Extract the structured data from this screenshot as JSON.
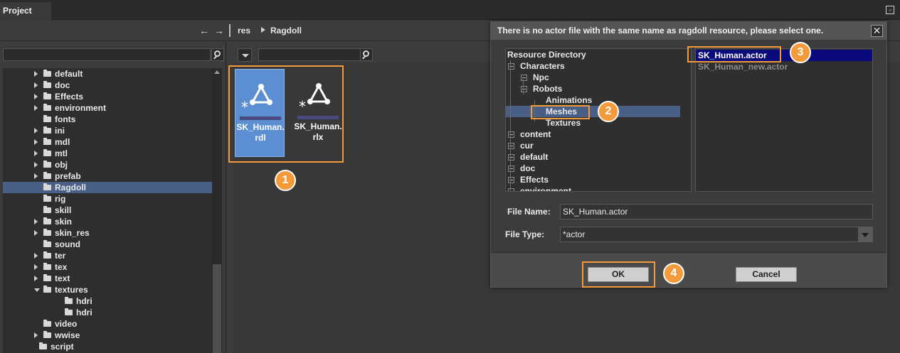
{
  "topbar": {
    "tab_label": "Project",
    "panel_icon": "restore-panel-icon"
  },
  "navbar": {
    "back": "←",
    "forward": "→",
    "crumbs": [
      "res",
      "Ragdoll"
    ]
  },
  "left_tree": {
    "items": [
      {
        "label": "default",
        "expanded": false,
        "has_arrow": true
      },
      {
        "label": "doc",
        "expanded": false,
        "has_arrow": true
      },
      {
        "label": "Effects",
        "expanded": false,
        "has_arrow": true
      },
      {
        "label": "environment",
        "expanded": false,
        "has_arrow": true
      },
      {
        "label": "fonts",
        "expanded": false,
        "has_arrow": false
      },
      {
        "label": "ini",
        "expanded": false,
        "has_arrow": true
      },
      {
        "label": "mdl",
        "expanded": false,
        "has_arrow": true
      },
      {
        "label": "mtl",
        "expanded": false,
        "has_arrow": true
      },
      {
        "label": "obj",
        "expanded": false,
        "has_arrow": true
      },
      {
        "label": "prefab",
        "expanded": false,
        "has_arrow": true
      },
      {
        "label": "Ragdoll",
        "expanded": false,
        "has_arrow": false,
        "selected": true
      },
      {
        "label": "rig",
        "expanded": false,
        "has_arrow": false
      },
      {
        "label": "skill",
        "expanded": false,
        "has_arrow": false
      },
      {
        "label": "skin",
        "expanded": false,
        "has_arrow": true
      },
      {
        "label": "skin_res",
        "expanded": false,
        "has_arrow": true
      },
      {
        "label": "sound",
        "expanded": false,
        "has_arrow": false
      },
      {
        "label": "ter",
        "expanded": false,
        "has_arrow": true
      },
      {
        "label": "tex",
        "expanded": false,
        "has_arrow": true
      },
      {
        "label": "text",
        "expanded": false,
        "has_arrow": true
      },
      {
        "label": "textures",
        "expanded": true,
        "has_arrow": true
      },
      {
        "label": "hdri",
        "expanded": false,
        "has_arrow": false,
        "child": true
      },
      {
        "label": "hdri",
        "expanded": false,
        "has_arrow": false,
        "child": true
      },
      {
        "label": "video",
        "expanded": false,
        "has_arrow": false
      },
      {
        "label": "wwise",
        "expanded": false,
        "has_arrow": true
      },
      {
        "label": "script",
        "expanded": false,
        "has_arrow": false,
        "root": true
      }
    ]
  },
  "files": [
    {
      "name": "SK_Human.rdl",
      "selected": true
    },
    {
      "name": "SK_Human.rlx",
      "selected": false
    }
  ],
  "dialog": {
    "title": "There is no actor file with the same name as ragdoll resource, please select one.",
    "close": "✕",
    "dir_tree": [
      {
        "label": "Resource Directory",
        "level": 0
      },
      {
        "label": "Characters",
        "level": 0
      },
      {
        "label": "Npc",
        "level": 1
      },
      {
        "label": "Robots",
        "level": 1
      },
      {
        "label": "Animations",
        "level": 2
      },
      {
        "label": "Meshes",
        "level": 2,
        "selected": true
      },
      {
        "label": "Textures",
        "level": 2
      },
      {
        "label": "content",
        "level": 0
      },
      {
        "label": "cur",
        "level": 0
      },
      {
        "label": "default",
        "level": 0
      },
      {
        "label": "doc",
        "level": 0
      },
      {
        "label": "Effects",
        "level": 0
      },
      {
        "label": "environment",
        "level": 0
      }
    ],
    "file_list": [
      {
        "label": "SK_Human.actor",
        "selected": true
      },
      {
        "label": "SK_Human_new.actor",
        "selected": false
      }
    ],
    "file_name_label": "File Name:",
    "file_name_value": "SK_Human.actor",
    "file_type_label": "File Type:",
    "file_type_value": "*actor",
    "ok_label": "OK",
    "cancel_label": "Cancel"
  },
  "steps": [
    "1",
    "2",
    "3",
    "4"
  ],
  "colors": {
    "highlight": "#f39a3a",
    "selection": "#4a5f85",
    "file_selected": "#5b8fd1",
    "list_selected": "#0a0a7c"
  }
}
